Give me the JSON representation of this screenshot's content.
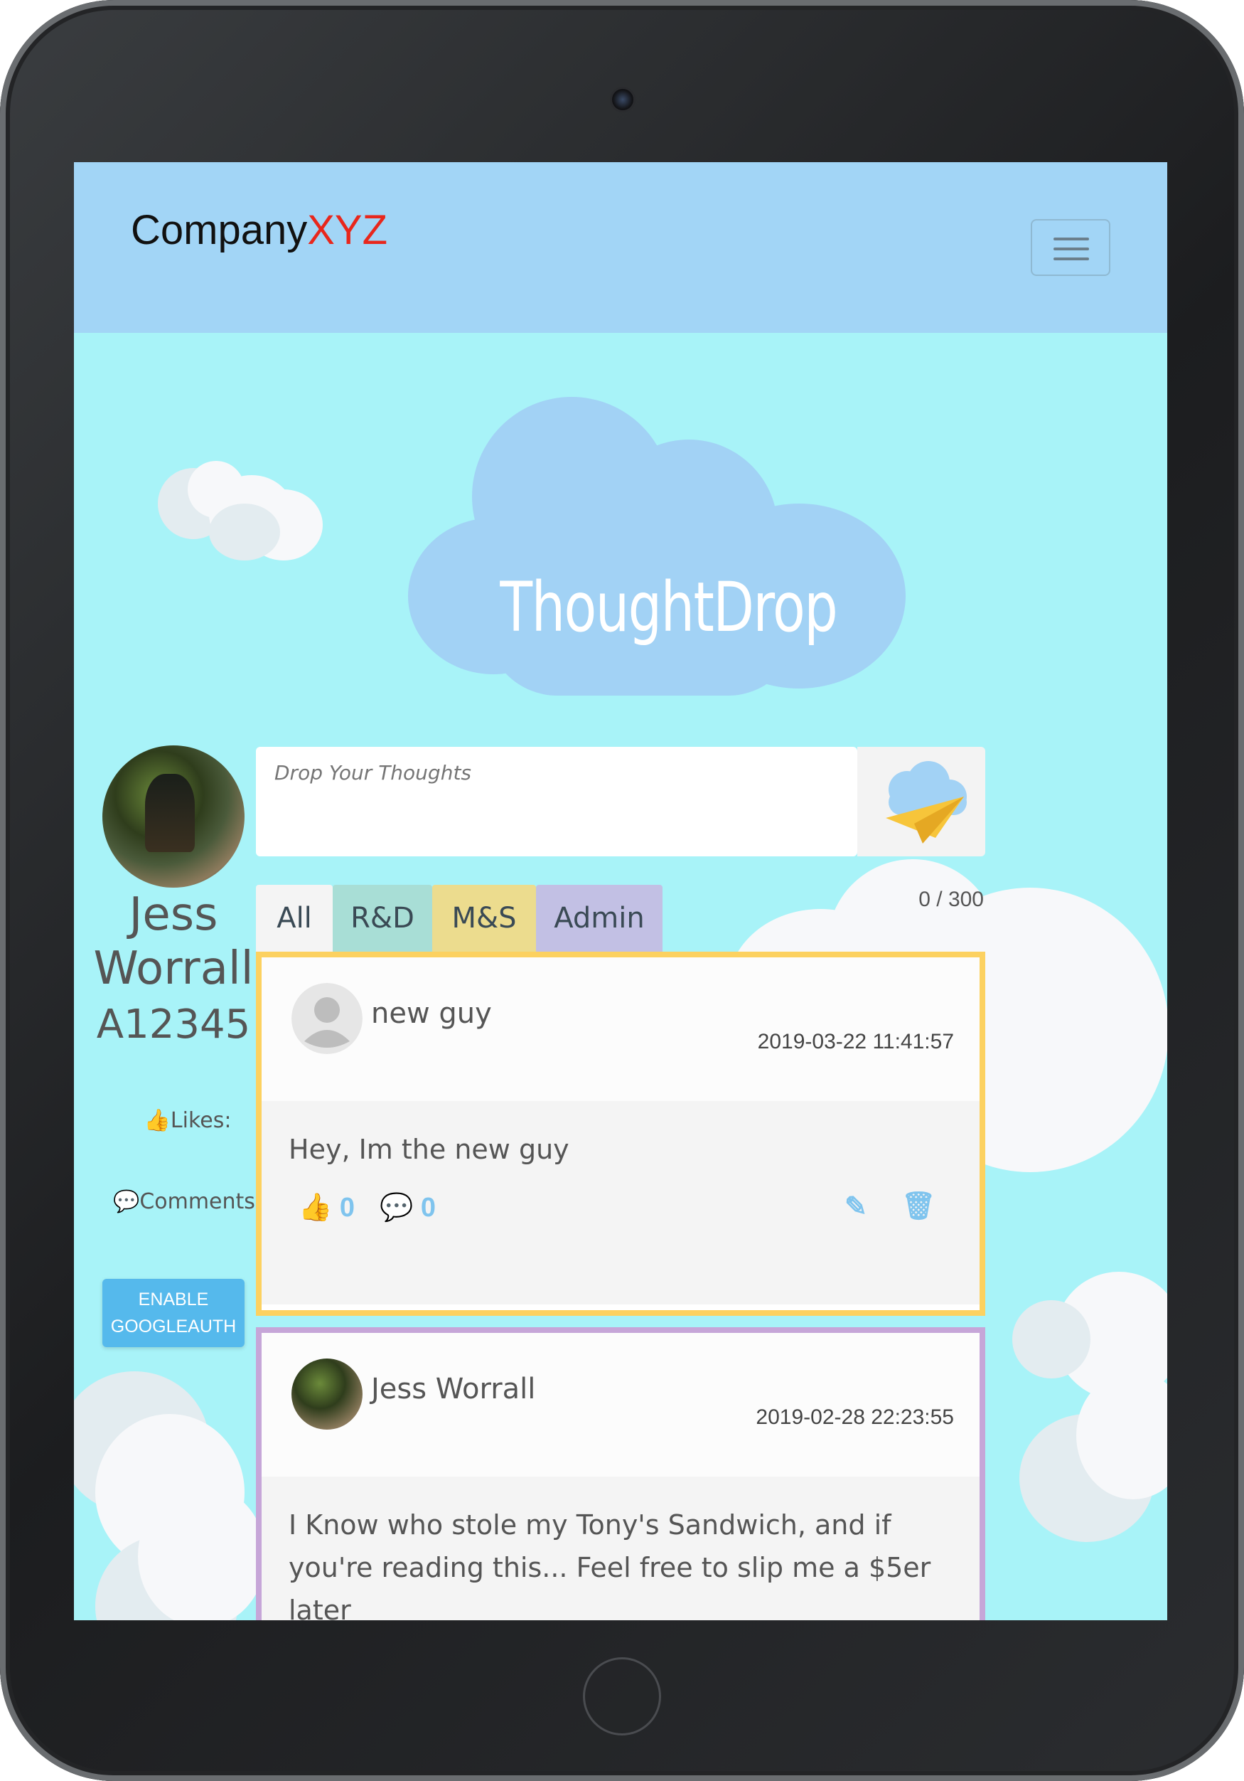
{
  "navbar": {
    "brand_main": "Company",
    "brand_accent": "XYZ"
  },
  "logo": {
    "text": "ThoughtDrop"
  },
  "profile": {
    "first_name": "Jess",
    "last_name": "Worrall",
    "employee_id": "A12345",
    "likes_label": "Likes:",
    "comments_label": "Comments:",
    "googleauth_line1": "ENABLE",
    "googleauth_line2": "GOOGLEAUTH"
  },
  "composer": {
    "placeholder": "Drop Your Thoughts",
    "counter": "0 / 300"
  },
  "tabs": [
    {
      "label": "All",
      "color": "#f4f4f4"
    },
    {
      "label": "R&D",
      "color": "#a8ded6"
    },
    {
      "label": "M&S",
      "color": "#ecdc8e"
    },
    {
      "label": "Admin",
      "color": "#c2c0e4"
    }
  ],
  "posts": [
    {
      "author": "new guy",
      "date": "2019-03-22 11:41:57",
      "text": "Hey, Im the new guy",
      "likes": "0",
      "comments": "0",
      "border_color": "#fcd160"
    },
    {
      "author": "Jess Worrall",
      "date": "2019-02-28 22:23:55",
      "text": "I Know who stole my Tony's Sandwich, and if you're reading this... Feel free to slip me a $5er later",
      "border_color": "#c6a6d8"
    }
  ],
  "icons": {
    "menu": "hamburger-icon",
    "send": "paper-plane-cloud-icon",
    "like": "thumbs-up-icon",
    "comment": "speech-bubble-icon",
    "edit": "edit-icon",
    "delete": "trash-icon"
  }
}
